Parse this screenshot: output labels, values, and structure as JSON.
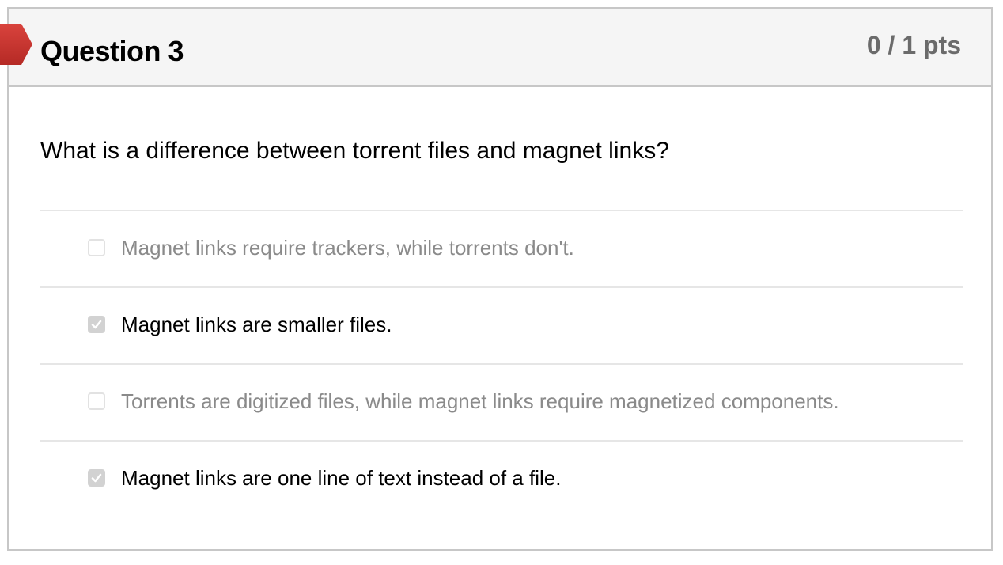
{
  "question": {
    "title": "Question 3",
    "points": "0 / 1 pts",
    "text": "What is a difference between torrent files and magnet links?",
    "status_color": "#c9302c"
  },
  "answers": [
    {
      "label": "Magnet links require trackers, while torrents don't.",
      "checked": false
    },
    {
      "label": "Magnet links are smaller files.",
      "checked": true
    },
    {
      "label": "Torrents are digitized files, while magnet links require magnetized components.",
      "checked": false
    },
    {
      "label": "Magnet links are one line of text instead of a file.",
      "checked": true
    }
  ]
}
